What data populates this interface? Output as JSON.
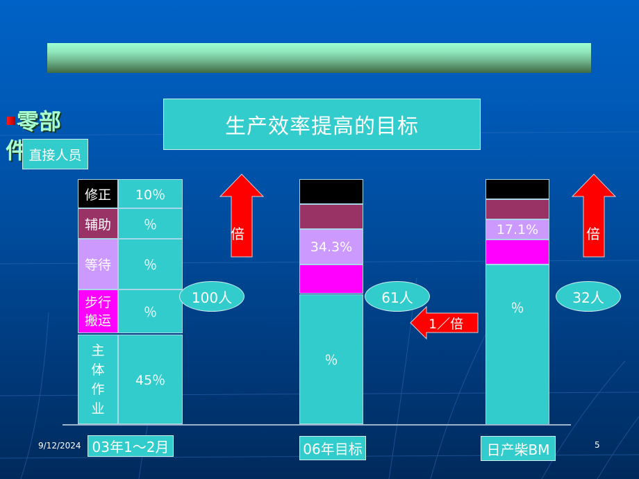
{
  "slide": {
    "title": "生产效率提高的目标",
    "bullet_text_line1": "零部",
    "bullet_text_line2": "件",
    "section_label": "直接人员",
    "footer_date": "9/12/2024",
    "page_number": "5"
  },
  "colors": {
    "background": "#0058b4",
    "teal": "#33cccc",
    "black": "#000000",
    "maroon": "#993366",
    "lavender": "#cc99ff",
    "magenta": "#ff00ff",
    "arrow_red": "#ff0000"
  },
  "chart_data": {
    "type": "bar",
    "stacked": true,
    "title": "生产效率提高的目标",
    "categories": [
      "03年1～2月",
      "06年目标",
      "日产柴BM"
    ],
    "headcount_labels": [
      "100人",
      "61人",
      "32人"
    ],
    "headcount": [
      100,
      61,
      32
    ],
    "segment_names": [
      "修正",
      "辅助",
      "等待",
      "步行搬运",
      "主体作业"
    ],
    "series": [
      {
        "name": "修正",
        "color": "#000000",
        "labels": [
          "10％",
          "",
          ""
        ]
      },
      {
        "name": "辅助",
        "color": "#993366",
        "labels": [
          "％",
          "",
          ""
        ]
      },
      {
        "name": "等待",
        "color": "#cc99ff",
        "labels": [
          "％",
          "34.3%",
          "17.1%"
        ]
      },
      {
        "name": "步行搬运",
        "color": "#ff00ff",
        "labels": [
          "％",
          "",
          ""
        ]
      },
      {
        "name": "主体作业",
        "color": "#33cccc",
        "labels": [
          "45％",
          "％",
          "％"
        ]
      }
    ],
    "annotations": [
      {
        "type": "up-arrow",
        "text": "倍",
        "position": "between 03年 and 06年"
      },
      {
        "type": "left-arrow",
        "text": "1／倍",
        "position": "between 06年 and 日产柴BM"
      },
      {
        "type": "up-arrow",
        "text": "倍",
        "position": "right of 日产柴BM"
      }
    ]
  },
  "table": {
    "rows": [
      {
        "label": "修正",
        "value": "10％"
      },
      {
        "label": "辅助",
        "value": "％"
      },
      {
        "label": "等待",
        "value": "％"
      },
      {
        "label": "步行\n搬运",
        "value": "％"
      },
      {
        "label": "主\n体\n作\n业",
        "value": "45％"
      }
    ]
  },
  "bars": {
    "middle": {
      "lavender_label": "34.3%",
      "teal_label": "％",
      "people": "61人",
      "category": "06年目标"
    },
    "right": {
      "lavender_label": "17.1%",
      "teal_label": "％",
      "people": "32人",
      "category": "日产柴BM"
    },
    "left": {
      "people": "100人",
      "category": "03年1～2月"
    }
  },
  "arrows": {
    "up_left_text": "倍",
    "left_text": "1／倍",
    "up_right_text": "倍"
  }
}
